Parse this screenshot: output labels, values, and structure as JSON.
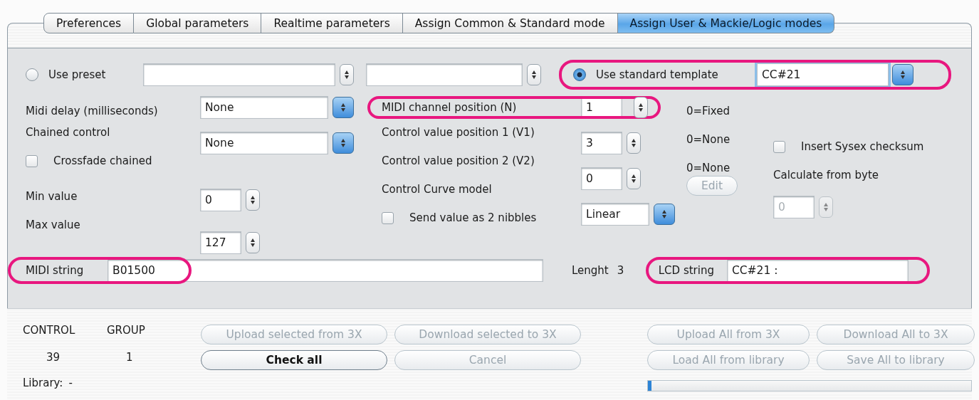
{
  "tabs": [
    {
      "label": "Preferences",
      "selected": false
    },
    {
      "label": "Global parameters",
      "selected": false
    },
    {
      "label": "Realtime parameters",
      "selected": false
    },
    {
      "label": "Assign Common & Standard mode",
      "selected": false
    },
    {
      "label": "Assign User & Mackie/Logic modes",
      "selected": true
    }
  ],
  "preset": {
    "label": "Use preset",
    "selected": false
  },
  "template": {
    "label": "Use standard template",
    "selected": true,
    "value": "CC#21",
    "highlighted": true
  },
  "midi_delay": {
    "label": "Midi delay (milliseconds)",
    "value": "None"
  },
  "chained_control": {
    "label": "Chained control",
    "value": "None"
  },
  "crossfade": {
    "label": "Crossfade chained",
    "checked": false
  },
  "min_value": {
    "label": "Min value",
    "value": "0"
  },
  "max_value": {
    "label": "Max value",
    "value": "127"
  },
  "midi_channel": {
    "label": "MIDI channel position (N)",
    "value": "1",
    "note": "0=Fixed",
    "highlighted": true
  },
  "value_1": {
    "label": "Control value position 1 (V1)",
    "value": "3",
    "note": "0=None"
  },
  "value_2": {
    "label": "Control value position 2 (V2)",
    "value": "0",
    "note": "0=None"
  },
  "curve": {
    "label": "Control Curve model",
    "value": "Linear"
  },
  "nibbles": {
    "label": "Send value as 2 nibbles",
    "checked": false
  },
  "edit_button": {
    "label": "Edit",
    "disabled": true
  },
  "sysex": {
    "label": "Insert Sysex checksum",
    "checked": false
  },
  "calc_from": {
    "label": "Calculate from byte",
    "value": "0",
    "disabled": true
  },
  "midi_string": {
    "label": "MIDI string",
    "value": "B01500",
    "highlighted": true
  },
  "length": {
    "label": "Lenght",
    "value": "3"
  },
  "lcd_string": {
    "label": "LCD string",
    "value": "CC#21 :",
    "highlighted": true
  },
  "control": {
    "label": "CONTROL",
    "value": "39"
  },
  "group": {
    "label": "GROUP",
    "value": "1"
  },
  "library": {
    "label": "Library:",
    "value": "-"
  },
  "left_buttons": [
    {
      "label": "Upload selected from 3X",
      "disabled": true
    },
    {
      "label": "Download selected to 3X",
      "disabled": true
    },
    {
      "label": "Check all",
      "disabled": false
    },
    {
      "label": "Cancel",
      "disabled": true
    }
  ],
  "right_buttons": [
    {
      "label": "Upload All from 3X",
      "disabled": true
    },
    {
      "label": "Download All to 3X",
      "disabled": true
    },
    {
      "label": "Load All from library",
      "disabled": true
    },
    {
      "label": "Save All to library",
      "disabled": true
    }
  ],
  "progress": {
    "level": 0.01
  }
}
